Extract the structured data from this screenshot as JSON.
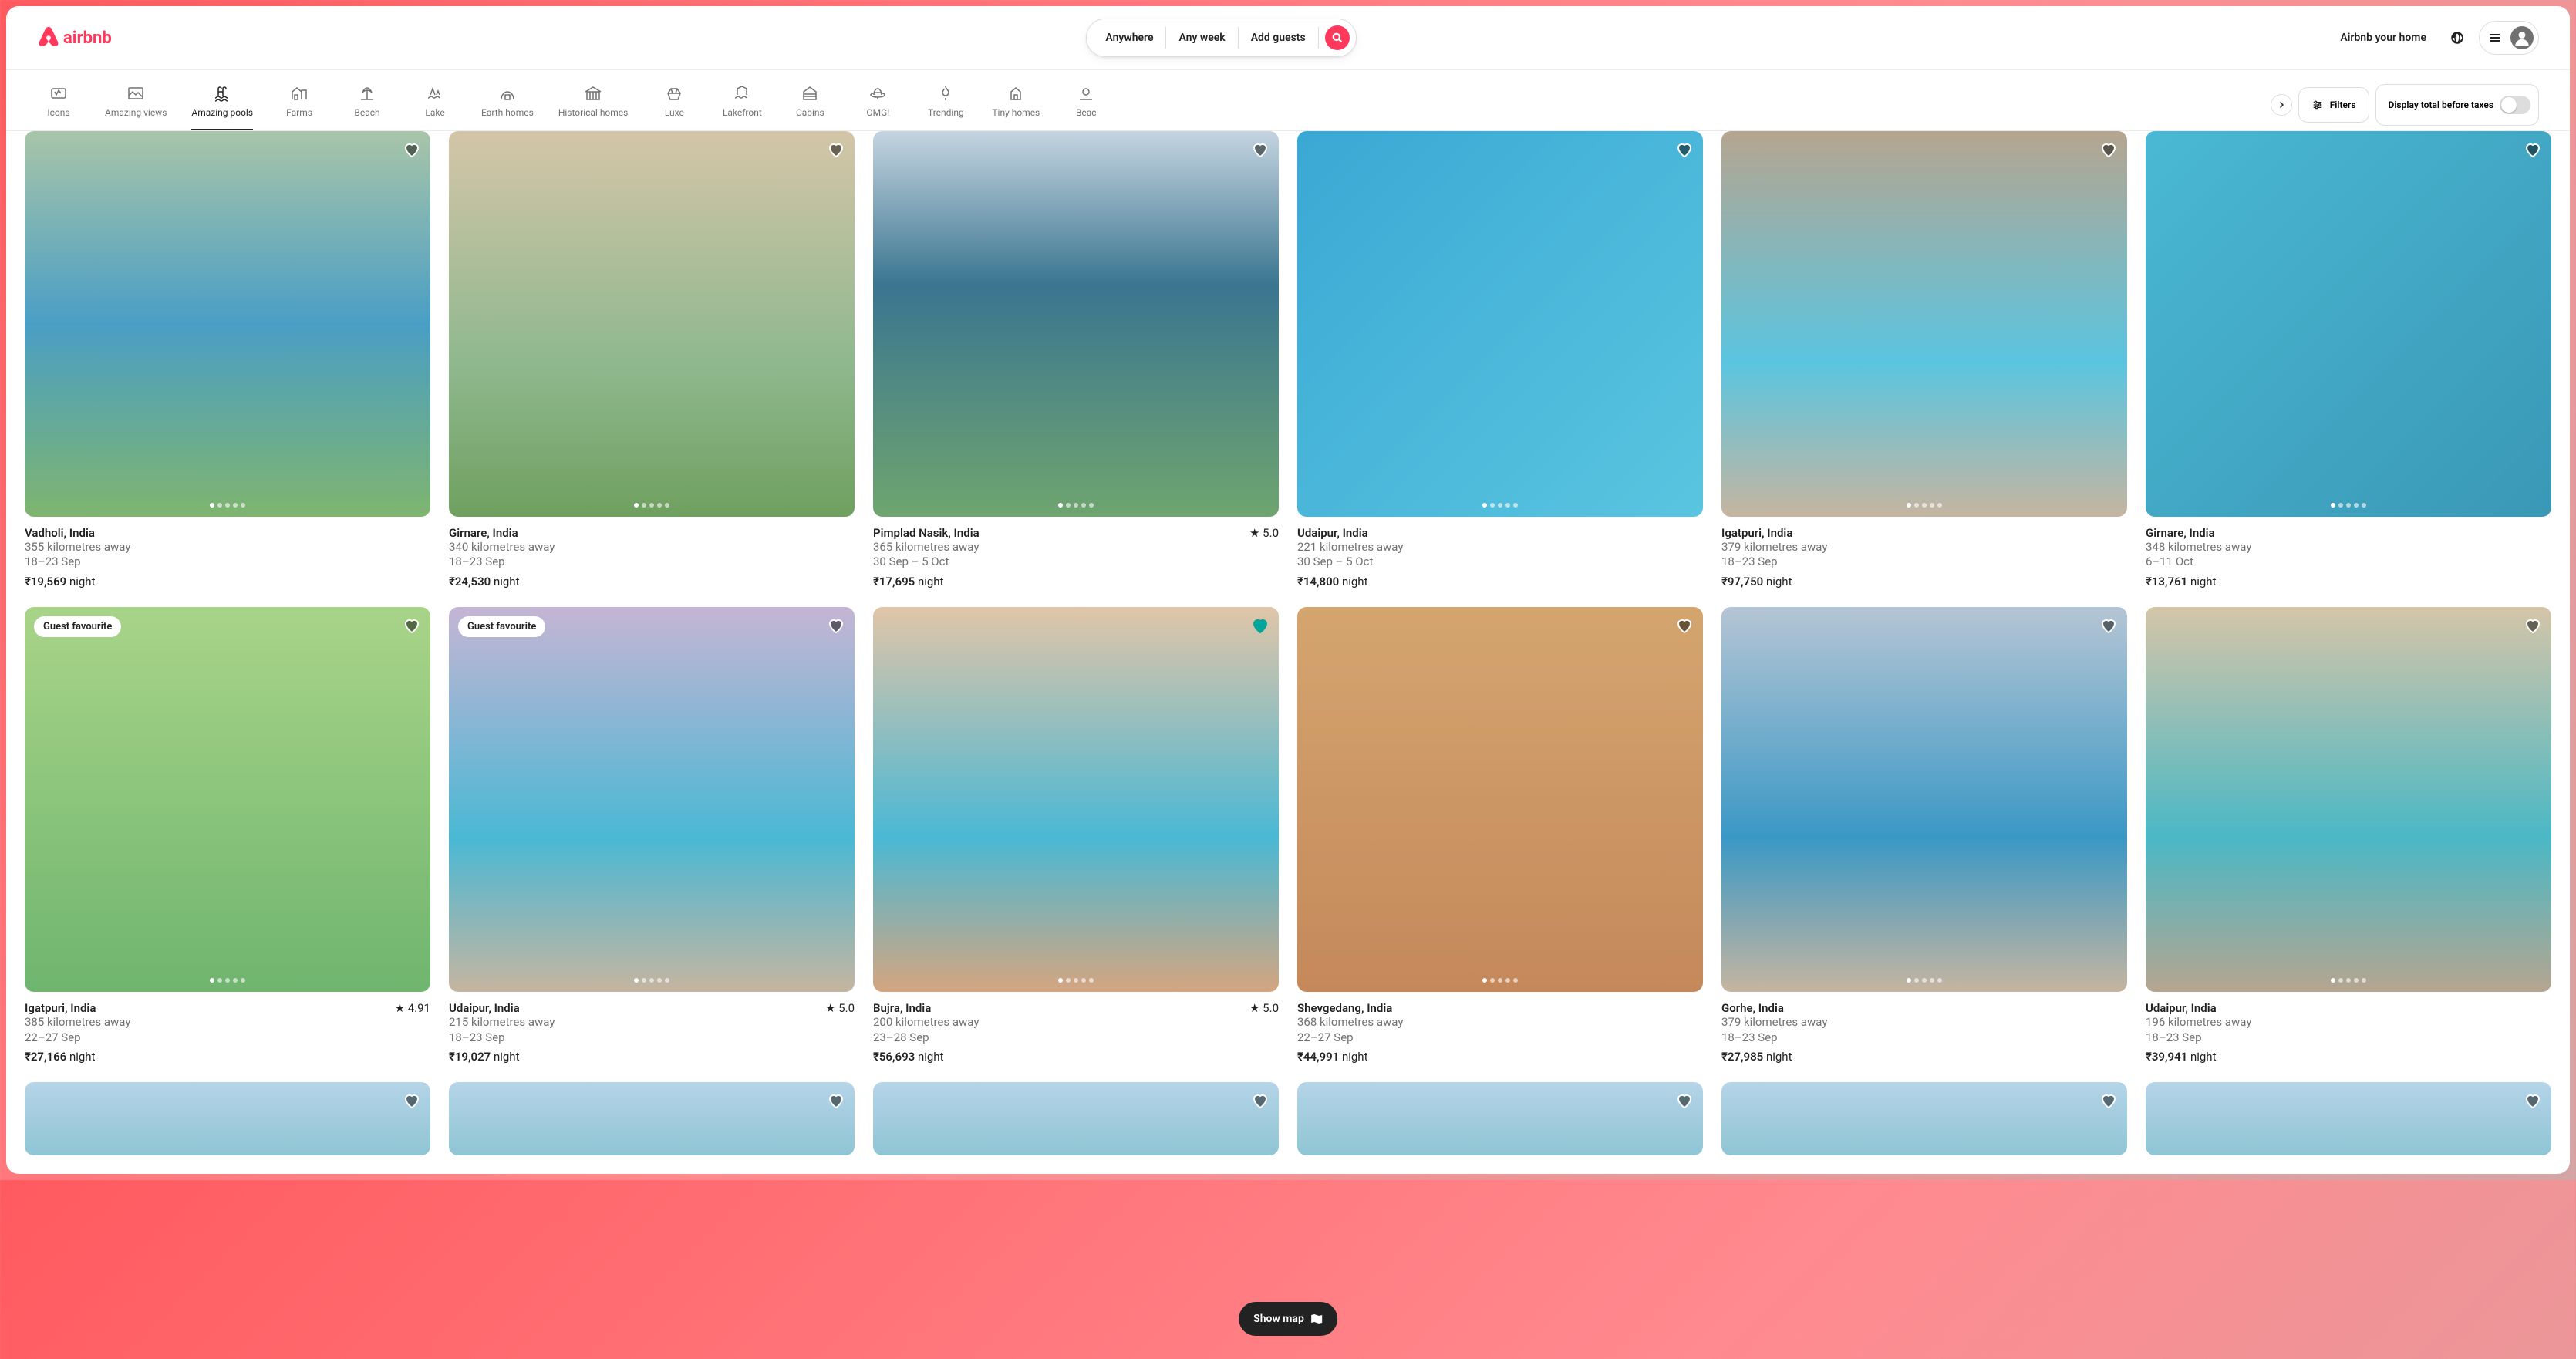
{
  "brand": "airbnb",
  "search": {
    "where": "Anywhere",
    "when": "Any week",
    "who": "Add guests"
  },
  "header": {
    "host_cta": "Airbnb your home"
  },
  "categories": [
    {
      "label": "Icons"
    },
    {
      "label": "Amazing views"
    },
    {
      "label": "Amazing pools",
      "active": true
    },
    {
      "label": "Farms"
    },
    {
      "label": "Beach"
    },
    {
      "label": "Lake"
    },
    {
      "label": "Earth homes"
    },
    {
      "label": "Historical homes"
    },
    {
      "label": "Luxe"
    },
    {
      "label": "Lakefront"
    },
    {
      "label": "Cabins"
    },
    {
      "label": "OMG!"
    },
    {
      "label": "Trending"
    },
    {
      "label": "Tiny homes"
    },
    {
      "label": "Beac"
    }
  ],
  "filters_label": "Filters",
  "toggle_label": "Display total before taxes",
  "badge_label": "Guest favourite",
  "night_label": "night",
  "listings": [
    {
      "location": "Vadholi, India",
      "distance": "355 kilometres away",
      "dates": "18–23 Sep",
      "price": "₹19,569",
      "rating": "",
      "fav": false,
      "badge": false,
      "cls": "pool1"
    },
    {
      "location": "Girnare, India",
      "distance": "340 kilometres away",
      "dates": "18–23 Sep",
      "price": "₹24,530",
      "rating": "",
      "fav": false,
      "badge": false,
      "cls": "pool2"
    },
    {
      "location": "Pimplad Nasik, India",
      "distance": "365 kilometres away",
      "dates": "30 Sep – 5 Oct",
      "price": "₹17,695",
      "rating": "5.0",
      "fav": false,
      "badge": false,
      "cls": "pool3"
    },
    {
      "location": "Udaipur, India",
      "distance": "221 kilometres away",
      "dates": "30 Sep – 5 Oct",
      "price": "₹14,800",
      "rating": "",
      "fav": false,
      "badge": false,
      "cls": "pool4"
    },
    {
      "location": "Igatpuri, India",
      "distance": "379 kilometres away",
      "dates": "18–23 Sep",
      "price": "₹97,750",
      "rating": "",
      "fav": false,
      "badge": false,
      "cls": "pool5"
    },
    {
      "location": "Girnare, India",
      "distance": "348 kilometres away",
      "dates": "6–11 Oct",
      "price": "₹13,761",
      "rating": "",
      "fav": false,
      "badge": false,
      "cls": "pool6"
    },
    {
      "location": "Igatpuri, India",
      "distance": "385 kilometres away",
      "dates": "22–27 Sep",
      "price": "₹27,166",
      "rating": "4.91",
      "fav": false,
      "badge": true,
      "cls": "pool7"
    },
    {
      "location": "Udaipur, India",
      "distance": "215 kilometres away",
      "dates": "18–23 Sep",
      "price": "₹19,027",
      "rating": "5.0",
      "fav": false,
      "badge": true,
      "cls": "pool8"
    },
    {
      "location": "Bujra, India",
      "distance": "200 kilometres away",
      "dates": "23–28 Sep",
      "price": "₹56,693",
      "rating": "5.0",
      "fav": true,
      "badge": false,
      "cls": "pool9"
    },
    {
      "location": "Shevgedang, India",
      "distance": "368 kilometres away",
      "dates": "22–27 Sep",
      "price": "₹44,991",
      "rating": "",
      "fav": false,
      "badge": false,
      "cls": "pool10"
    },
    {
      "location": "Gorhe, India",
      "distance": "379 kilometres away",
      "dates": "18–23 Sep",
      "price": "₹27,985",
      "rating": "",
      "fav": false,
      "badge": false,
      "cls": "pool11"
    },
    {
      "location": "Udaipur, India",
      "distance": "196 kilometres away",
      "dates": "18–23 Sep",
      "price": "₹39,941",
      "rating": "",
      "fav": false,
      "badge": false,
      "cls": "pool12"
    }
  ],
  "show_map_label": "Show map"
}
